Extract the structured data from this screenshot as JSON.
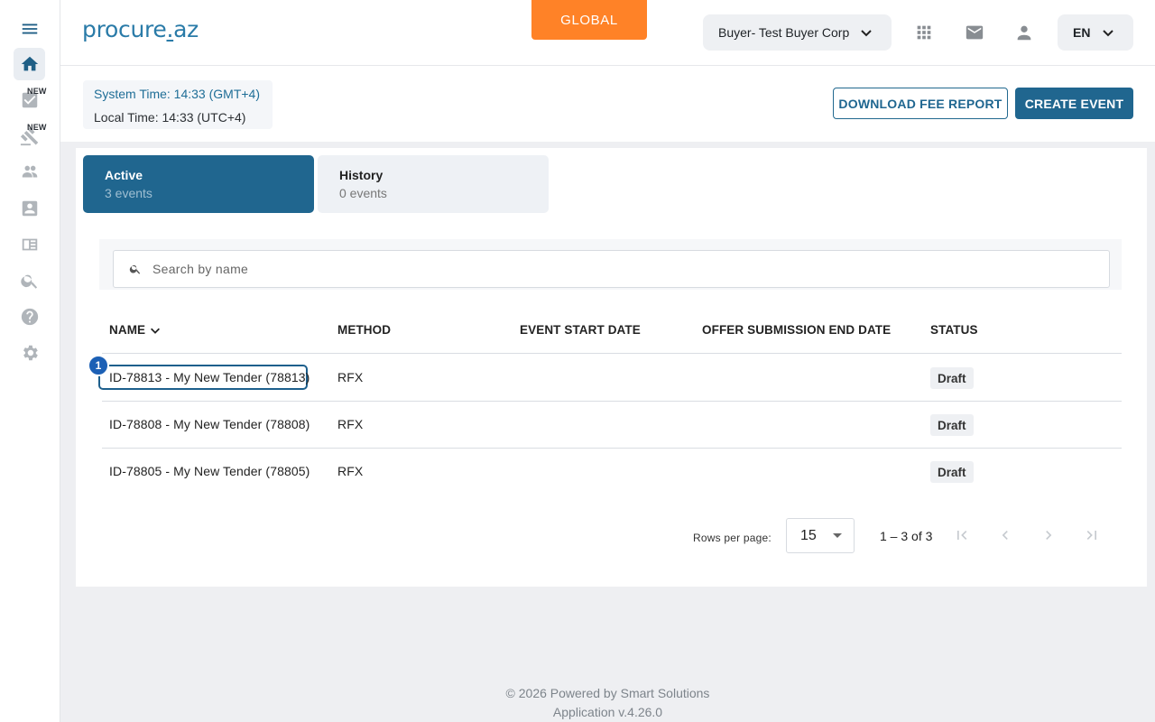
{
  "header": {
    "logo_text": "procure",
    "logo_domain": "az",
    "global_label": "GLOBAL",
    "company_select": "Buyer- Test Buyer Corp",
    "language_select": "EN"
  },
  "sidebar": {
    "items": [
      {
        "icon": "menu-icon"
      },
      {
        "icon": "home-icon",
        "active": true
      },
      {
        "icon": "tasks-icon",
        "badge": "NEW"
      },
      {
        "icon": "auction-icon",
        "badge": "NEW"
      },
      {
        "icon": "people-icon"
      },
      {
        "icon": "contact-card-icon"
      },
      {
        "icon": "catalog-icon"
      },
      {
        "icon": "search-icon"
      },
      {
        "icon": "help-icon"
      },
      {
        "icon": "settings-icon"
      }
    ]
  },
  "subbar": {
    "system_time": "System Time: 14:33 (GMT+4)",
    "local_time": "Local Time: 14:33 (UTC+4)",
    "download_fee_report": "DOWNLOAD FEE REPORT",
    "create_event": "CREATE EVENT"
  },
  "tabs": [
    {
      "label": "Active",
      "sub": "3 events"
    },
    {
      "label": "History",
      "sub": "0 events"
    }
  ],
  "search": {
    "placeholder": "Search by name",
    "value": ""
  },
  "table": {
    "columns": [
      "NAME",
      "METHOD",
      "EVENT START DATE",
      "OFFER SUBMISSION END DATE",
      "STATUS"
    ],
    "rows": [
      {
        "name": "ID-78813 - My New Tender (78813)",
        "method": "RFX",
        "start": "",
        "end": "",
        "status": "Draft"
      },
      {
        "name": "ID-78808 - My New Tender (78808)",
        "method": "RFX",
        "start": "",
        "end": "",
        "status": "Draft"
      },
      {
        "name": "ID-78805 - My New Tender (78805)",
        "method": "RFX",
        "start": "",
        "end": "",
        "status": "Draft"
      }
    ],
    "focused_row_marker": "1"
  },
  "pagination": {
    "rows_per_page_label": "Rows per page:",
    "rows_per_page_value": "15",
    "range": "1 – 3 of 3"
  },
  "footer": {
    "line1": "© 2026 Powered by Smart Solutions",
    "line2": "Application v.4.26.0"
  },
  "colors": {
    "primary": "#20668f",
    "accent_orange": "#ff8227",
    "marker_blue": "#1c60b5"
  }
}
